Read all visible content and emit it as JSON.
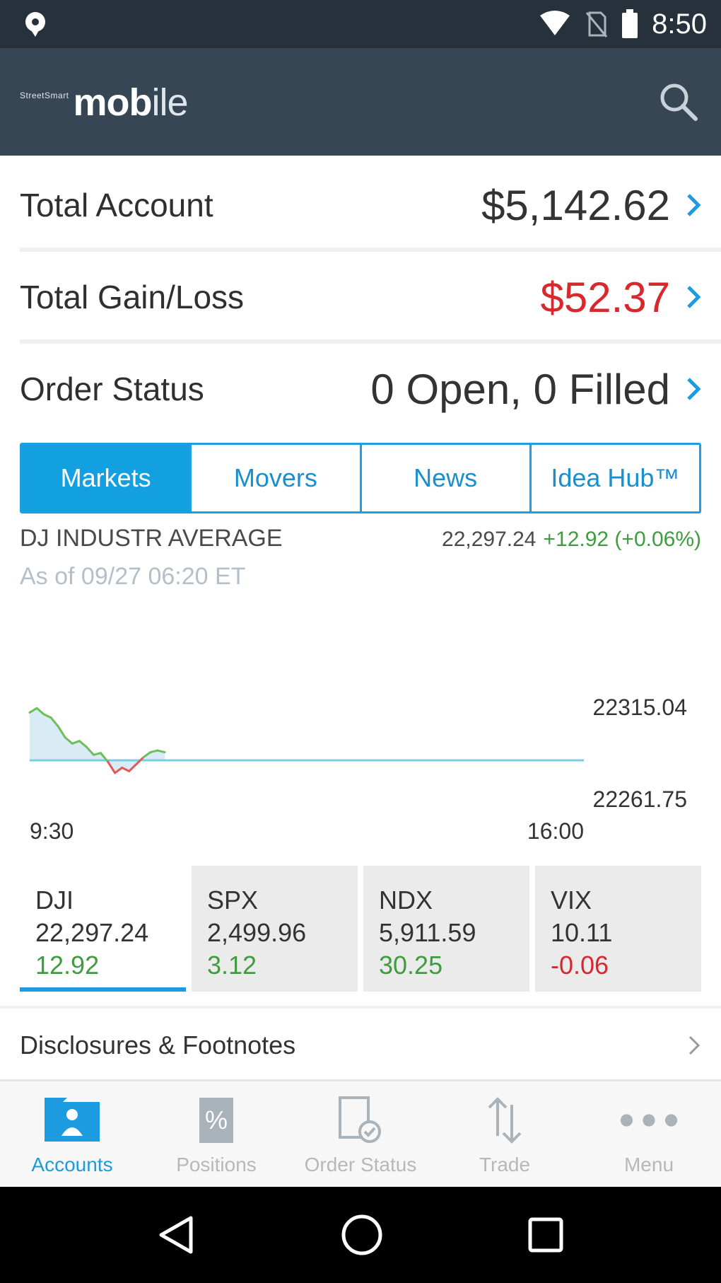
{
  "status_bar": {
    "time": "8:50"
  },
  "header": {
    "brand_small": "StreetSmart",
    "brand_big": "mob",
    "brand_big_thin": "ile"
  },
  "summary": [
    {
      "label": "Total Account",
      "value": "$5,142.62"
    },
    {
      "label": "Total Gain/Loss",
      "value": "$52.37"
    },
    {
      "label": "Order Status",
      "value": "0 Open, 0 Filled"
    }
  ],
  "tabs": [
    "Markets",
    "Movers",
    "News",
    "Idea Hub™"
  ],
  "quote": {
    "name": "DJ INDUSTR AVERAGE",
    "as_of": "As of 09/27 06:20 ET",
    "last": "22,297.24",
    "change": "+12.92 (+0.06%)"
  },
  "chart_data": {
    "type": "area",
    "x_ticks": [
      "9:30",
      "16:00"
    ],
    "y_ticks": [
      "22315.04",
      "22261.75"
    ],
    "ylim": [
      22261.75,
      22315.04
    ],
    "baseline": 22284.32,
    "x": [
      0,
      1,
      2,
      3,
      4,
      5,
      6,
      7,
      8,
      9,
      10,
      11,
      12,
      13,
      14,
      15,
      16,
      17,
      18,
      19,
      20,
      21,
      22,
      23,
      24,
      25
    ],
    "y": [
      22312.0,
      22314.5,
      22311.0,
      22309.0,
      22304.0,
      22297.5,
      22294.0,
      22295.5,
      22292.0,
      22287.5,
      22288.5,
      22283.5,
      22277.0,
      22280.0,
      22278.0,
      22282.0,
      22286.0,
      22289.0,
      22290.0,
      22289.0,
      22289.0,
      22289.0,
      22289.0,
      22289.0,
      22289.0,
      22289.0
    ],
    "valid_points": 20,
    "total_points": 79,
    "colors": {
      "up": "#6cbf5a",
      "down": "#e0585b",
      "fill": "#d9ecf5",
      "baseline": "#7ccbe6"
    }
  },
  "indices": [
    {
      "symbol": "DJI",
      "price": "22,297.24",
      "change": "12.92",
      "negative": false
    },
    {
      "symbol": "SPX",
      "price": "2,499.96",
      "change": "3.12",
      "negative": false
    },
    {
      "symbol": "NDX",
      "price": "5,911.59",
      "change": "30.25",
      "negative": false
    },
    {
      "symbol": "VIX",
      "price": "10.11",
      "change": "-0.06",
      "negative": true
    }
  ],
  "disclosures": {
    "label": "Disclosures & Footnotes"
  },
  "bottom_nav": [
    {
      "label": "Accounts",
      "icon": "accounts-icon"
    },
    {
      "label": "Positions",
      "icon": "positions-icon"
    },
    {
      "label": "Order Status",
      "icon": "order-status-icon"
    },
    {
      "label": "Trade",
      "icon": "trade-icon"
    },
    {
      "label": "Menu",
      "icon": "more-icon"
    }
  ],
  "colors": {
    "accent": "#12a0e0",
    "header": "#364655",
    "negative": "#d9272e",
    "positive": "#3f9c3f"
  }
}
